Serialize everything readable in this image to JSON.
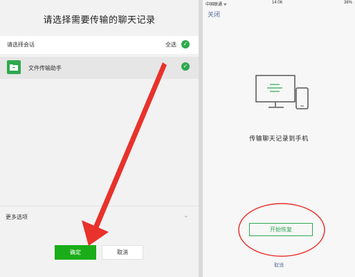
{
  "left": {
    "title": "请选择需要传输的聊天记录",
    "section_label": "请选择会话",
    "select_all_label": "全选",
    "chat_item_name": "文件传输助手",
    "more_options_label": "更多选项",
    "confirm_label": "确定",
    "cancel_label": "取消"
  },
  "right": {
    "status": {
      "carrier": "中国联通 ᯤ",
      "time": "14:06",
      "battery": "38%"
    },
    "close_label": "关闭",
    "transfer_text": "传输聊天记录到手机",
    "start_restore_label": "开始恢复",
    "cancel_label": "取消"
  },
  "colors": {
    "accent_green": "#1aad19",
    "check_green": "#2ea84f",
    "link_blue": "#576b95",
    "annotation_red": "#e8322b"
  },
  "icons": {
    "check": "check-icon",
    "folder": "folder-icon",
    "chevron": "chevron-down-icon",
    "devices": "computer-phone-icon"
  }
}
